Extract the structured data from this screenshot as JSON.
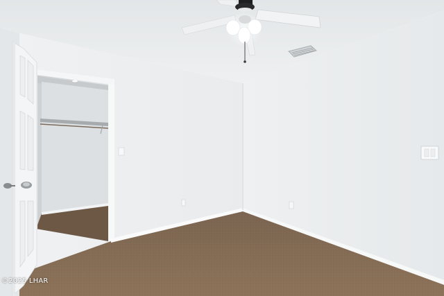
{
  "photo": {
    "watermark": "©2025 LHAR",
    "colors": {
      "ceiling": "#e9ebec",
      "left_wall": "#eceef0",
      "right_wall": "#eaecee",
      "closet_interior": "#d5d9dc",
      "carpet": "#846c55",
      "baseboard": "#fafafa",
      "door": "#f4f5f6"
    }
  }
}
